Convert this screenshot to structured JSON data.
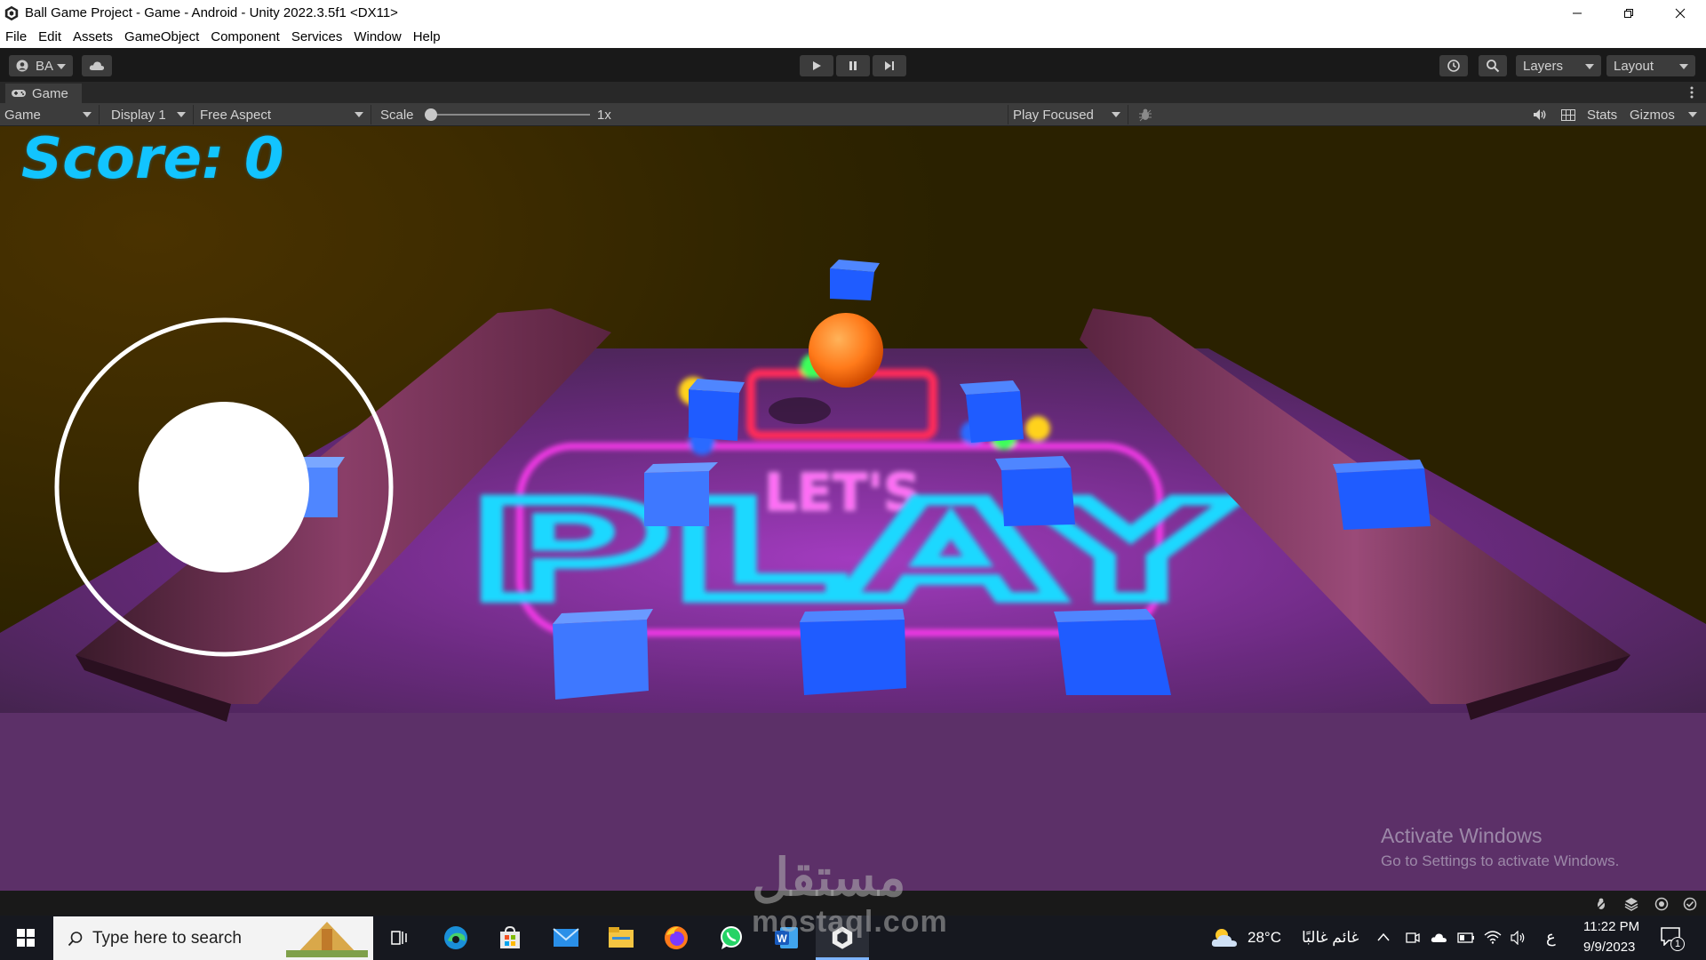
{
  "window": {
    "title": "Ball Game Project - Game - Android - Unity 2022.3.5f1 <DX11>"
  },
  "menu": [
    "File",
    "Edit",
    "Assets",
    "GameObject",
    "Component",
    "Services",
    "Window",
    "Help"
  ],
  "toolbar": {
    "account_label": "BA",
    "layers_label": "Layers",
    "layout_label": "Layout"
  },
  "tab": {
    "label": "Game"
  },
  "game_controls": {
    "view_dropdown": "Game",
    "display_dropdown": "Display 1",
    "aspect_dropdown": "Free Aspect",
    "scale_label": "Scale",
    "scale_value": "1x",
    "play_mode_dropdown": "Play Focused",
    "stats_label": "Stats",
    "gizmos_label": "Gizmos"
  },
  "game": {
    "score_text": "Score: 0",
    "floor_text_top": "LET'S",
    "floor_text_main": "PLAY"
  },
  "watermarks": {
    "activate_title": "Activate Windows",
    "activate_subtitle": "Go to Settings to activate Windows.",
    "mostaql_arabic": "مستقل",
    "mostaql_url": "mostaql.com"
  },
  "taskbar": {
    "search_placeholder": "Type here to search",
    "weather_temp": "28°C",
    "weather_desc": "غائم غالبًا",
    "input_lang": "ع",
    "time": "11:22 PM",
    "date": "9/9/2023",
    "notification_count": "1"
  },
  "colors": {
    "score": "#12c4ff",
    "ball": "#ff7a1a",
    "cubes": "#1f5cff",
    "unity_dark": "#191919",
    "unity_panel": "#3c3c3c"
  }
}
